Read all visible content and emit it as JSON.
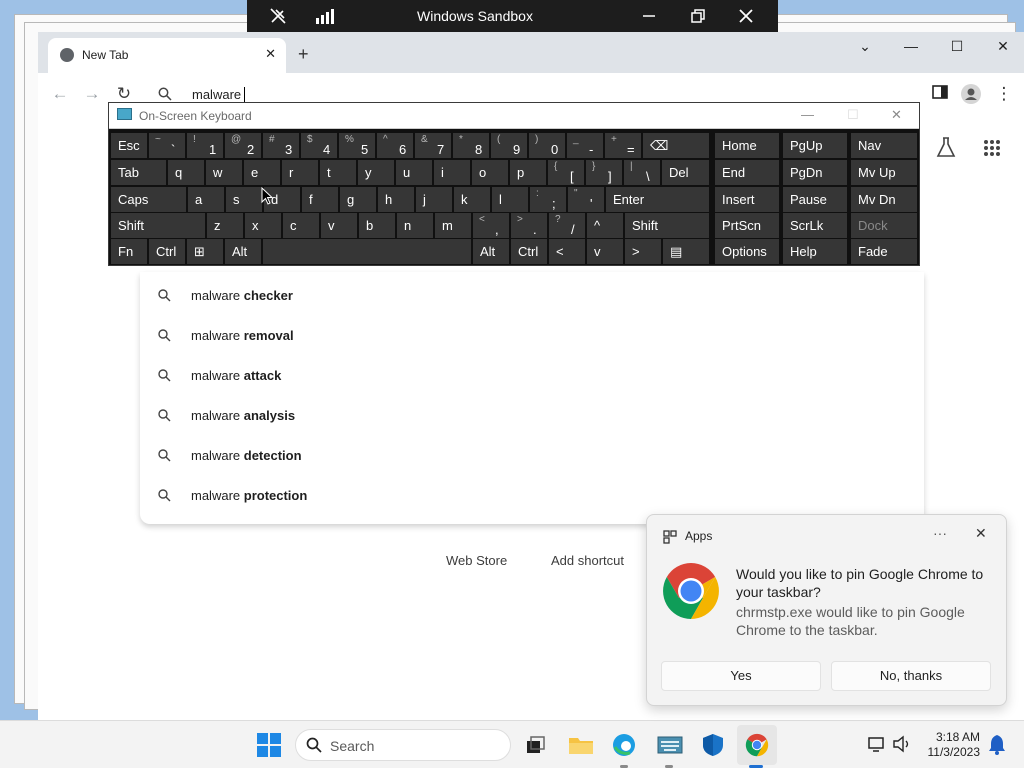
{
  "sandbox": {
    "title": "Windows Sandbox"
  },
  "chrome": {
    "tab_title": "New Tab",
    "omnibox_text": "malware",
    "suggestions": [
      {
        "prefix": "malware ",
        "bold": "checker"
      },
      {
        "prefix": "malware ",
        "bold": "removal"
      },
      {
        "prefix": "malware ",
        "bold": "attack"
      },
      {
        "prefix": "malware ",
        "bold": "analysis"
      },
      {
        "prefix": "malware ",
        "bold": "detection"
      },
      {
        "prefix": "malware ",
        "bold": "protection"
      }
    ],
    "shortcuts": [
      "Web Store",
      "Add shortcut"
    ]
  },
  "osk": {
    "title": "On-Screen Keyboard",
    "row1": [
      {
        "label": "Esc"
      },
      {
        "shift": "~",
        "label": "`"
      },
      {
        "shift": "!",
        "label": "1"
      },
      {
        "shift": "@",
        "label": "2"
      },
      {
        "shift": "#",
        "label": "3"
      },
      {
        "shift": "$",
        "label": "4"
      },
      {
        "shift": "%",
        "label": "5"
      },
      {
        "shift": "^",
        "label": "6"
      },
      {
        "shift": "&",
        "label": "7"
      },
      {
        "shift": "*",
        "label": "8"
      },
      {
        "shift": "(",
        "label": "9"
      },
      {
        "shift": ")",
        "label": "0"
      },
      {
        "shift": "_",
        "label": "-"
      },
      {
        "shift": "+",
        "label": "="
      },
      {
        "label": "⌫"
      }
    ],
    "row2": [
      {
        "label": "Tab"
      },
      {
        "label": "q"
      },
      {
        "label": "w"
      },
      {
        "label": "e"
      },
      {
        "label": "r"
      },
      {
        "label": "t"
      },
      {
        "label": "y"
      },
      {
        "label": "u"
      },
      {
        "label": "i"
      },
      {
        "label": "o"
      },
      {
        "label": "p"
      },
      {
        "shift": "{",
        "label": "["
      },
      {
        "shift": "}",
        "label": "]"
      },
      {
        "shift": "|",
        "label": "\\"
      },
      {
        "label": "Del"
      }
    ],
    "row3": [
      {
        "label": "Caps"
      },
      {
        "label": "a"
      },
      {
        "label": "s"
      },
      {
        "label": "d"
      },
      {
        "label": "f"
      },
      {
        "label": "g"
      },
      {
        "label": "h"
      },
      {
        "label": "j"
      },
      {
        "label": "k"
      },
      {
        "label": "l"
      },
      {
        "shift": ":",
        "label": ";"
      },
      {
        "shift": "\"",
        "label": "'"
      },
      {
        "label": "Enter"
      }
    ],
    "row4": [
      {
        "label": "Shift"
      },
      {
        "label": "z"
      },
      {
        "label": "x"
      },
      {
        "label": "c"
      },
      {
        "label": "v"
      },
      {
        "label": "b"
      },
      {
        "label": "n"
      },
      {
        "label": "m"
      },
      {
        "shift": "<",
        "label": ","
      },
      {
        "shift": ">",
        "label": "."
      },
      {
        "shift": "?",
        "label": "/"
      },
      {
        "label": "^"
      },
      {
        "label": "Shift"
      }
    ],
    "row5": [
      {
        "label": "Fn"
      },
      {
        "label": "Ctrl"
      },
      {
        "label": "⊞"
      },
      {
        "label": "Alt"
      },
      {
        "label": ""
      },
      {
        "label": "Alt"
      },
      {
        "label": "Ctrl"
      },
      {
        "label": "<"
      },
      {
        "label": "v"
      },
      {
        "label": ">"
      },
      {
        "label": "▤"
      }
    ],
    "side": [
      [
        "Home",
        "PgUp",
        "Nav"
      ],
      [
        "End",
        "PgDn",
        "Mv Up"
      ],
      [
        "Insert",
        "Pause",
        "Mv Dn"
      ],
      [
        "PrtScn",
        "ScrLk",
        "Dock"
      ],
      [
        "Options",
        "Help",
        "Fade"
      ]
    ]
  },
  "toast": {
    "app": "Apps",
    "question": "Would you like to pin Google Chrome to your taskbar?",
    "detail": "chrmstp.exe would like to pin Google Chrome to the taskbar.",
    "yes": "Yes",
    "no": "No, thanks"
  },
  "taskbar": {
    "search_placeholder": "Search",
    "time": "3:18 AM",
    "date": "11/3/2023"
  }
}
